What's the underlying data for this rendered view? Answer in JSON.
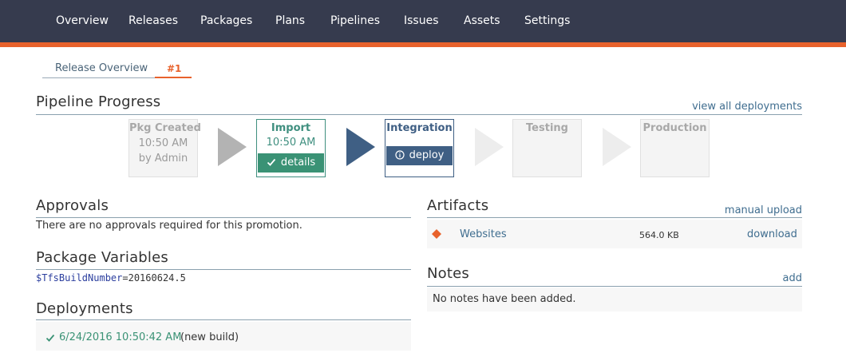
{
  "nav": {
    "items": [
      "Overview",
      "Releases",
      "Packages",
      "Plans",
      "Pipelines",
      "Issues",
      "Assets",
      "Settings"
    ]
  },
  "subtabs": {
    "overview": "Release Overview",
    "active": "#1"
  },
  "pipeline": {
    "title": "Pipeline Progress",
    "link": "view all deployments",
    "stages": [
      {
        "name": "Pkg Created",
        "line1": "10:50 AM",
        "line2": "by Admin"
      },
      {
        "name": "Import",
        "line1": "10:50 AM",
        "button": "details"
      },
      {
        "name": "Integration",
        "button": "deploy"
      },
      {
        "name": "Testing"
      },
      {
        "name": "Production"
      }
    ]
  },
  "approvals": {
    "title": "Approvals",
    "text": "There are no approvals required for this promotion."
  },
  "variables": {
    "title": "Package Variables",
    "name": "$TfsBuildNumber",
    "value": "=20160624.5"
  },
  "deployments": {
    "title": "Deployments",
    "items": [
      {
        "date": "6/24/2016 10:50:42 AM",
        "note": "(new build)"
      }
    ]
  },
  "artifacts": {
    "title": "Artifacts",
    "link": "manual upload",
    "items": [
      {
        "name": "Websites",
        "size": "564.0 KB",
        "action": "download"
      }
    ]
  },
  "notes": {
    "title": "Notes",
    "link": "add",
    "text": "No notes have been added."
  },
  "colors": {
    "nav_bg": "#363b4e",
    "accent": "#e8622c",
    "success": "#3a9275",
    "primary": "#3f5f84"
  },
  "icons": {
    "check": "check-icon",
    "info": "info-circle-icon",
    "artifact": "diamond-icon"
  }
}
